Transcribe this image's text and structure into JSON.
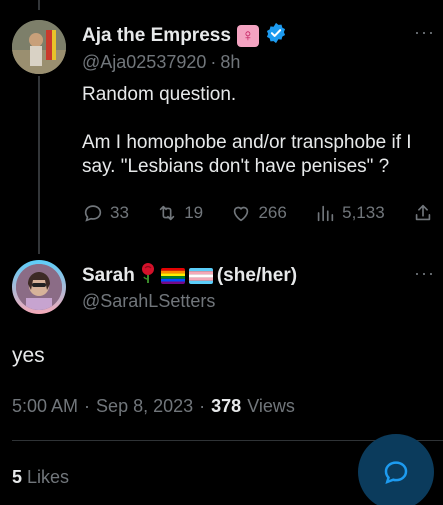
{
  "original_post": {
    "author_name": "Aja the Empress",
    "author_emoji": "♀",
    "handle": "@Aja02537920",
    "separator": "·",
    "time": "8h",
    "more": "···",
    "text_line1": "Random question.",
    "text_line2": "Am I homophobe and/or transphobe if I say. \"Lesbians don't have penises\" ?",
    "replies": "33",
    "reposts": "19",
    "likes": "266",
    "views": "5,133"
  },
  "reply_post": {
    "author_name": "Sarah",
    "pronouns": "(she/her)",
    "handle": "@SarahLSetters",
    "more": "···",
    "text": "yes",
    "time": "5:00 AM",
    "sep1": "·",
    "date": "Sep 8, 2023",
    "sep2": "·",
    "views_count": "378",
    "views_label": "Views",
    "likes_count": "5",
    "likes_label": "Likes"
  },
  "colors": {
    "accent": "#1d9bf0",
    "muted": "#71767b",
    "text": "#e7e9ea",
    "background": "#000000",
    "fab_bg": "#0b3b5c"
  }
}
